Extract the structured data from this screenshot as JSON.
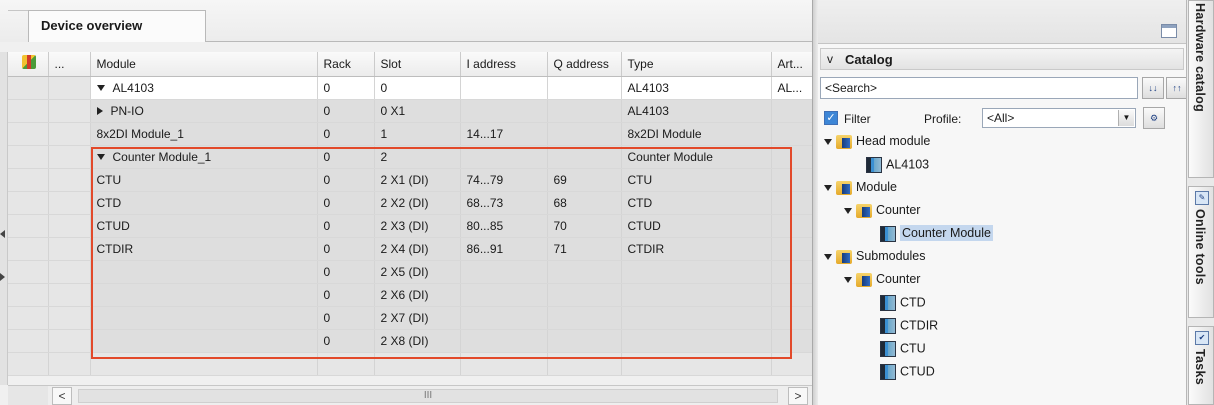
{
  "device_overview": {
    "tab_title": "Device overview",
    "columns": [
      "",
      "...",
      "Module",
      "Rack",
      "Slot",
      "I address",
      "Q address",
      "Type",
      "Art..."
    ],
    "rows": [
      {
        "indent": 1,
        "expander": "down",
        "module": "AL4103",
        "rack": "0",
        "slot": "0",
        "i_address": "",
        "q_address": "",
        "type": "AL4103",
        "art": "AL...",
        "style": "white"
      },
      {
        "indent": 2,
        "expander": "right",
        "module": "PN-IO",
        "rack": "0",
        "slot": "0 X1",
        "i_address": "",
        "q_address": "",
        "type": "AL4103",
        "art": "",
        "style": "grey"
      },
      {
        "indent": 1,
        "expander": "",
        "module": "8x2DI Module_1",
        "rack": "0",
        "slot": "1",
        "i_address": "14...17",
        "q_address": "",
        "type": "8x2DI Module",
        "art": "",
        "style": "grey"
      },
      {
        "indent": 1,
        "expander": "down",
        "module": "Counter Module_1",
        "rack": "0",
        "slot": "2",
        "i_address": "",
        "q_address": "",
        "type": "Counter Module",
        "art": "",
        "style": "grey"
      },
      {
        "indent": 3,
        "expander": "",
        "module": "CTU",
        "rack": "0",
        "slot": "2 X1 (DI)",
        "i_address": "74...79",
        "q_address": "69",
        "type": "CTU",
        "art": "",
        "style": "grey"
      },
      {
        "indent": 3,
        "expander": "",
        "module": "CTD",
        "rack": "0",
        "slot": "2 X2 (DI)",
        "i_address": "68...73",
        "q_address": "68",
        "type": "CTD",
        "art": "",
        "style": "grey"
      },
      {
        "indent": 3,
        "expander": "",
        "module": "CTUD",
        "rack": "0",
        "slot": "2 X3 (DI)",
        "i_address": "80...85",
        "q_address": "70",
        "type": "CTUD",
        "art": "",
        "style": "grey"
      },
      {
        "indent": 3,
        "expander": "",
        "module": "CTDIR",
        "rack": "0",
        "slot": "2 X4 (DI)",
        "i_address": "86...91",
        "q_address": "71",
        "type": "CTDIR",
        "art": "",
        "style": "grey"
      },
      {
        "indent": 0,
        "expander": "",
        "module": "",
        "rack": "0",
        "slot": "2 X5 (DI)",
        "i_address": "",
        "q_address": "",
        "type": "",
        "art": "",
        "style": "grey"
      },
      {
        "indent": 0,
        "expander": "",
        "module": "",
        "rack": "0",
        "slot": "2 X6 (DI)",
        "i_address": "",
        "q_address": "",
        "type": "",
        "art": "",
        "style": "grey"
      },
      {
        "indent": 0,
        "expander": "",
        "module": "",
        "rack": "0",
        "slot": "2 X7 (DI)",
        "i_address": "",
        "q_address": "",
        "type": "",
        "art": "",
        "style": "grey"
      },
      {
        "indent": 0,
        "expander": "",
        "module": "",
        "rack": "0",
        "slot": "2 X8 (DI)",
        "i_address": "",
        "q_address": "",
        "type": "",
        "art": "",
        "style": "grey"
      },
      {
        "indent": 0,
        "expander": "",
        "module": "",
        "rack": "",
        "slot": "",
        "i_address": "",
        "q_address": "",
        "type": "",
        "art": "",
        "style": "empty"
      }
    ],
    "scroll_left": "<",
    "scroll_right": ">",
    "scroll_thumb": "III",
    "highlight_color": "#e2492a"
  },
  "catalog": {
    "header": "Catalog",
    "chevron": "v",
    "search_placeholder": "<Search>",
    "filter_label": "Filter",
    "profile_label": "Profile:",
    "profile_value": "<All>",
    "tree": [
      {
        "level": 0,
        "expander": true,
        "icon": "folder",
        "label": "Head module"
      },
      {
        "level": 2,
        "expander": false,
        "icon": "module",
        "label": "AL4103"
      },
      {
        "level": 0,
        "expander": true,
        "icon": "folder",
        "label": "Module"
      },
      {
        "level": 1,
        "expander": true,
        "icon": "folder",
        "label": "Counter"
      },
      {
        "level": 3,
        "expander": false,
        "icon": "module",
        "label": "Counter Module",
        "selected": true
      },
      {
        "level": 0,
        "expander": true,
        "icon": "folder",
        "label": "Submodules"
      },
      {
        "level": 1,
        "expander": true,
        "icon": "folder",
        "label": "Counter"
      },
      {
        "level": 3,
        "expander": false,
        "icon": "module",
        "label": "CTD"
      },
      {
        "level": 3,
        "expander": false,
        "icon": "module",
        "label": "CTDIR"
      },
      {
        "level": 3,
        "expander": false,
        "icon": "module",
        "label": "CTU"
      },
      {
        "level": 3,
        "expander": false,
        "icon": "module",
        "label": "CTUD"
      }
    ]
  },
  "side_tabs": [
    "Hardware catalog",
    "Online tools",
    "Tasks"
  ]
}
